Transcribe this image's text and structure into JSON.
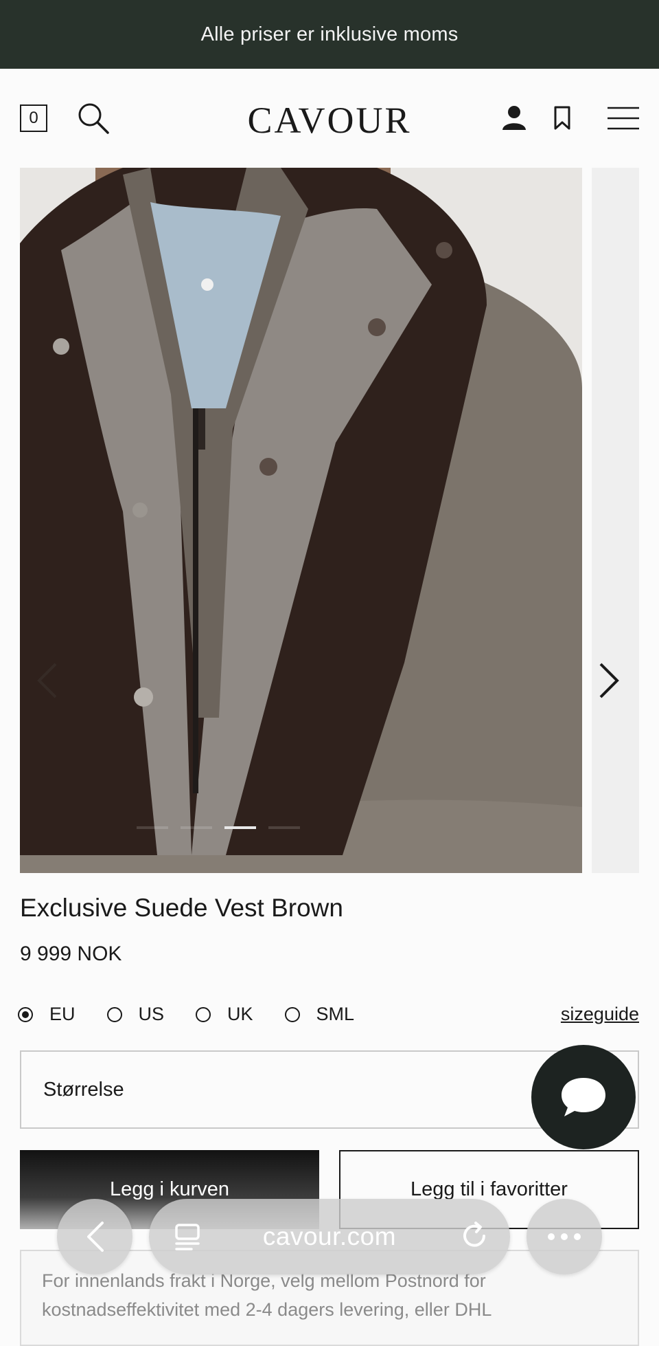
{
  "promo": {
    "text": "Alle priser er inklusive moms"
  },
  "header": {
    "cart_count": "0",
    "logo": "CAVOUR"
  },
  "product": {
    "title": "Exclusive Suede Vest Brown",
    "price": "9 999 NOK",
    "gallery_active_index": 2,
    "gallery_dot_count": 4
  },
  "size_units": [
    {
      "label": "EU",
      "selected": true
    },
    {
      "label": "US",
      "selected": false
    },
    {
      "label": "UK",
      "selected": false
    },
    {
      "label": "SML",
      "selected": false
    }
  ],
  "sizeguide_label": "sizeguide",
  "size_select": {
    "placeholder": "Størrelse"
  },
  "buttons": {
    "add_to_cart": "Legg i kurven",
    "add_to_favorites": "Legg til i favoritter"
  },
  "shipping_text": "For innenlands frakt i Norge, velg mellom Postnord for kostnadseffektivitet med 2-4 dagers levering, eller DHL",
  "browser": {
    "url": "cavour.com"
  },
  "colors": {
    "promo_bg": "#28322b",
    "chat_bg": "#1d2321",
    "vest": "#3a2a24"
  },
  "icons": [
    "search-icon",
    "user-icon",
    "bookmark-icon",
    "menu-icon",
    "chevron-left-icon",
    "chevron-right-icon",
    "chat-icon",
    "back-icon",
    "tabs-icon",
    "reload-icon",
    "more-icon"
  ]
}
